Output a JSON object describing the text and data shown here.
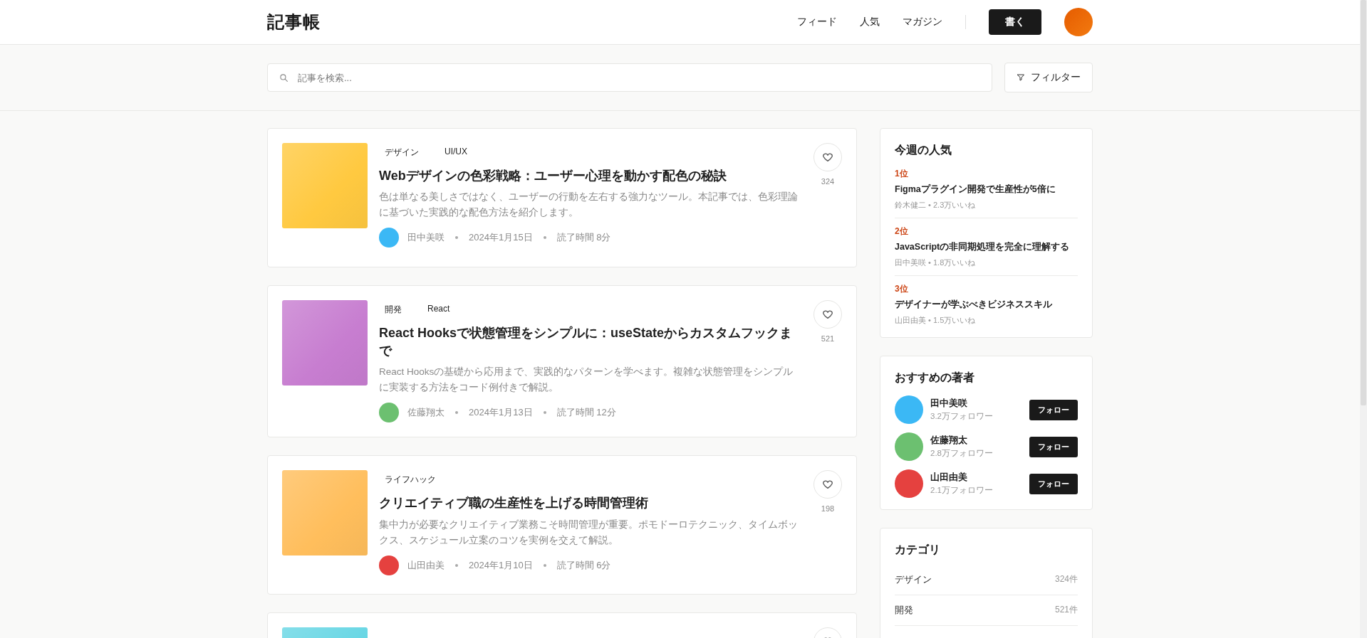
{
  "header": {
    "logo": "記事帳",
    "nav": [
      "フィード",
      "人気",
      "マガジン"
    ],
    "write_button": "書く"
  },
  "search": {
    "placeholder": "記事を検索...",
    "filter_button": "フィルター"
  },
  "articles": [
    {
      "color": "#ffc940",
      "tags": [
        "デザイン",
        "UI/UX"
      ],
      "title": "Webデザインの色彩戦略：ユーザー心理を動かす配色の秘訣",
      "excerpt": "色は単なる美しさではなく、ユーザーの行動を左右する強力なツール。本記事では、色彩理論に基づいた実践的な配色方法を紹介します。",
      "author": {
        "name": "田中美咲",
        "color": "#3bb8f5"
      },
      "date": "2024年1月15日",
      "read_time": "読了時間 8分",
      "likes": "324"
    },
    {
      "color": "#c77dd0",
      "tags": [
        "開発",
        "React"
      ],
      "title": "React Hooksで状態管理をシンプルに：useStateからカスタムフックまで",
      "excerpt": "React Hooksの基礎から応用まで、実践的なパターンを学べます。複雑な状態管理をシンプルに実装する方法をコード例付きで解説。",
      "author": {
        "name": "佐藤翔太",
        "color": "#6cc070"
      },
      "date": "2024年1月13日",
      "read_time": "読了時間 12分",
      "likes": "521"
    },
    {
      "color": "#ffbe5c",
      "tags": [
        "ライフハック"
      ],
      "title": "クリエイティブ職の生産性を上げる時間管理術",
      "excerpt": "集中力が必要なクリエイティブ業務こそ時間管理が重要。ポモドーロテクニック、タイムボックス、スケジュール立案のコツを実例を交えて解説。",
      "author": {
        "name": "山田由美",
        "color": "#e5413f"
      },
      "date": "2024年1月10日",
      "read_time": "読了時間 6分",
      "likes": "198"
    },
    {
      "color": "#66d6e4"
    }
  ],
  "popular": {
    "title": "今週の人気",
    "items": [
      {
        "rank": "1位",
        "title": "Figmaプラグイン開発で生産性が5倍に",
        "meta": "鈴木健二 • 2.3万いいね"
      },
      {
        "rank": "2位",
        "title": "JavaScriptの非同期処理を完全に理解する",
        "meta": "田中美咲 • 1.8万いいね"
      },
      {
        "rank": "3位",
        "title": "デザイナーが学ぶべきビジネススキル",
        "meta": "山田由美 • 1.5万いいね"
      }
    ]
  },
  "authors": {
    "title": "おすすめの著者",
    "items": [
      {
        "name": "田中美咲",
        "followers": "3.2万フォロワー",
        "color": "#3bb8f5",
        "button": "フォロー"
      },
      {
        "name": "佐藤翔太",
        "followers": "2.8万フォロワー",
        "color": "#6cc070",
        "button": "フォロー"
      },
      {
        "name": "山田由美",
        "followers": "2.1万フォロワー",
        "color": "#e5413f",
        "button": "フォロー"
      }
    ]
  },
  "categories": {
    "title": "カテゴリ",
    "items": [
      {
        "name": "デザイン",
        "count": "324件"
      },
      {
        "name": "開発",
        "count": "521件"
      }
    ]
  }
}
